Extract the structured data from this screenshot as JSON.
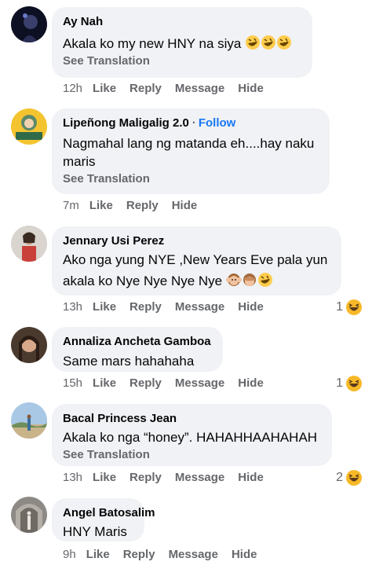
{
  "labels": {
    "see_translation": "See Translation",
    "like": "Like",
    "reply": "Reply",
    "message": "Message",
    "hide": "Hide",
    "follow": "Follow",
    "dot": "·"
  },
  "comments": [
    {
      "author": "Ay Nah",
      "text": "Akala ko my new HNY na siya",
      "time": "12h",
      "emojis": "rofl x3"
    },
    {
      "author": "Lipeñong Maligalig 2.0",
      "text_line1": "Nagmahal lang ng matanda eh....hay naku",
      "text_line2": "maris",
      "time": "7m"
    },
    {
      "author": "Jennary Usi Perez",
      "text_line1": "Ako nga yung NYE ,New Years Eve pala yun",
      "text_line2": "akala ko Nye Nye Nye Nye",
      "time": "13h",
      "reaction_count": "1",
      "reaction": "haha"
    },
    {
      "author": "Annaliza Ancheta Gamboa",
      "text": "Same mars hahahaha",
      "time": "15h",
      "reaction_count": "1",
      "reaction": "haha"
    },
    {
      "author": "Bacal Princess Jean",
      "text": "Akala ko nga “honey”. HAHAHHAAHAHAH",
      "time": "13h",
      "reaction_count": "2",
      "reaction": "haha"
    },
    {
      "author": "Angel Batosalim",
      "text": "HNY Maris",
      "time": "9h"
    }
  ],
  "colors": {
    "bubble": "#f0f2f5",
    "secondary_text": "#65676b",
    "link_blue": "#1877f2",
    "emoji_yellow": "#ffcc4d"
  }
}
